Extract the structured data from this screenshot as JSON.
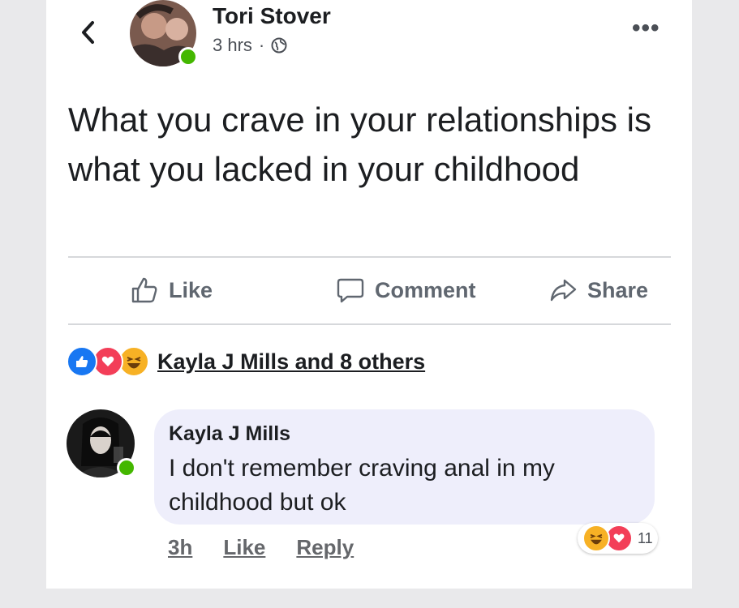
{
  "post": {
    "author": "Tori Stover",
    "time": "3 hrs",
    "separator": "·",
    "text": "What you crave in your relationships is what you lacked in your childhood"
  },
  "actions": {
    "like": "Like",
    "comment": "Comment",
    "share": "Share"
  },
  "reactions": {
    "summary": "Kayla J Mills and 8 others"
  },
  "comment": {
    "author": "Kayla J Mills",
    "text": "I don't remember craving anal in my childhood but ok",
    "time": "3h",
    "like": "Like",
    "reply": "Reply",
    "reaction_count": "11"
  },
  "colors": {
    "like_blue": "#1877f2",
    "love_red": "#f33e58",
    "haha_yellow": "#f7b125",
    "online_green": "#44b700",
    "comment_bubble": "#eeeefb"
  }
}
